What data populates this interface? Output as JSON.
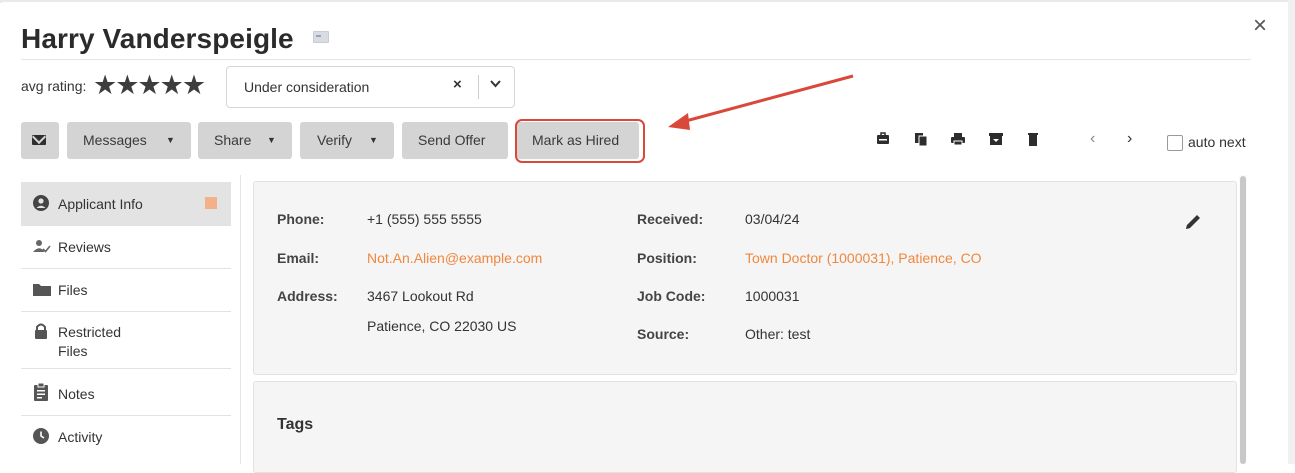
{
  "applicant": {
    "name": "Harry Vanderspeigle"
  },
  "rating": {
    "label": "avg rating:",
    "stars": "★★★★★",
    "value": 5,
    "max": 5
  },
  "status": {
    "value": "Under consideration",
    "clear": "×",
    "chevron": "⌄"
  },
  "toolbar": {
    "messages": "Messages",
    "share": "Share",
    "verify": "Verify",
    "send_offer": "Send Offer",
    "mark_hired": "Mark as Hired",
    "caret": "▼",
    "prev": "‹",
    "next": "›",
    "auto_next": "auto next",
    "close": "×"
  },
  "sidebar": {
    "items": [
      {
        "label": "Applicant Info",
        "icon": "person-circle-icon"
      },
      {
        "label": "Reviews",
        "icon": "person-check-icon"
      },
      {
        "label": "Files",
        "icon": "folder-icon"
      },
      {
        "label": "Restricted",
        "label2": "Files",
        "icon": "lock-icon"
      },
      {
        "label": "Notes",
        "icon": "clipboard-icon"
      },
      {
        "label": "Activity",
        "icon": "clock-icon"
      }
    ]
  },
  "details": {
    "phone_label": "Phone:",
    "phone": "+1 (555) 555 5555",
    "email_label": "Email:",
    "email": "Not.An.Alien@example.com",
    "address_label": "Address:",
    "address_line1": "3467 Lookout Rd",
    "address_line2": "Patience, CO 22030 US",
    "received_label": "Received:",
    "received": "03/04/24",
    "position_label": "Position:",
    "position": "Town Doctor (1000031), Patience, CO",
    "job_code_label": "Job Code:",
    "job_code": "1000031",
    "source_label": "Source:",
    "source": "Other: test"
  },
  "tags": {
    "title": "Tags"
  },
  "colors": {
    "accent": "#f0873e",
    "highlight": "#d8493a",
    "button": "#d4d4d4"
  }
}
